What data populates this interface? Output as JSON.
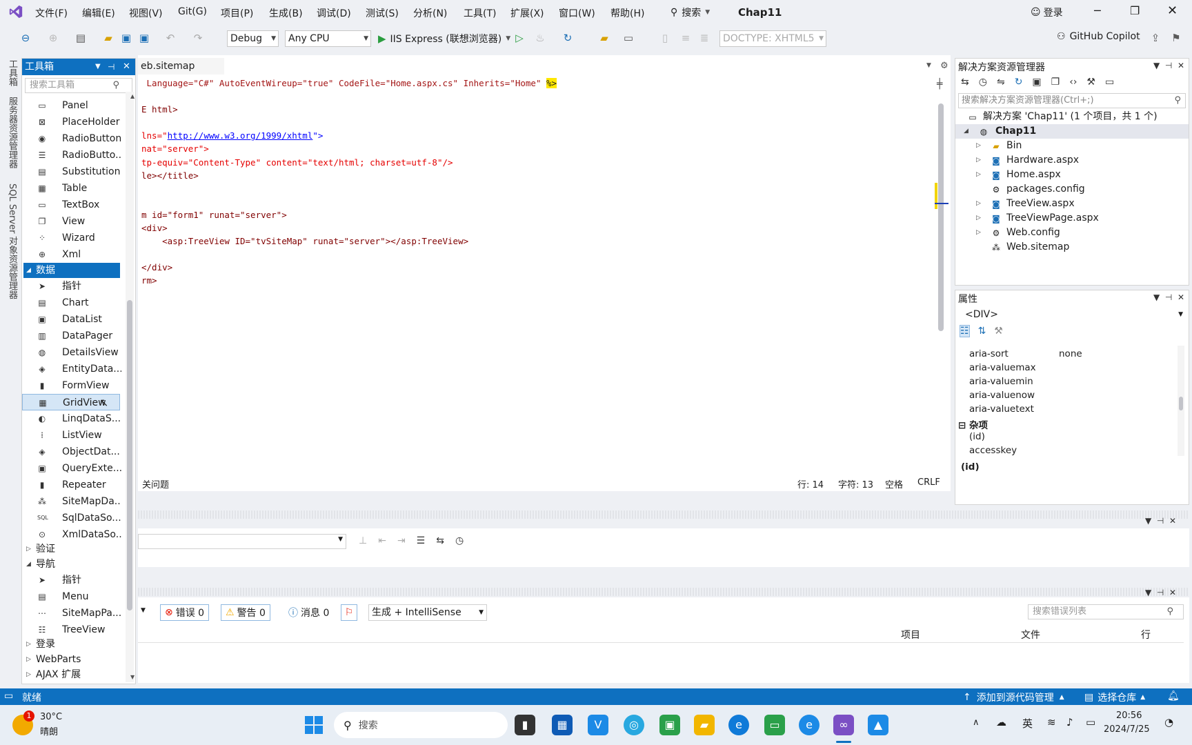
{
  "menu": {
    "items": [
      "文件(F)",
      "编辑(E)",
      "视图(V)",
      "Git(G)",
      "项目(P)",
      "生成(B)",
      "调试(D)",
      "测试(S)",
      "分析(N)",
      "工具(T)",
      "扩展(X)",
      "窗口(W)",
      "帮助(H)"
    ],
    "search": "搜索",
    "project_title": "Chap11",
    "login": "登录"
  },
  "toolbar": {
    "config": "Debug",
    "platform": "Any CPU",
    "run_target": "IIS Express (联想浏览器)",
    "doctype": "DOCTYPE: XHTML5",
    "copilot": "GitHub Copilot"
  },
  "vstrip": {
    "items": [
      "工具箱",
      "服务器资源管理器",
      "SQL Server 对象资源管理器"
    ]
  },
  "toolbox": {
    "title": "工具箱",
    "search_placeholder": "搜索工具箱",
    "items_top": [
      "Panel",
      "PlaceHolder",
      "RadioButton",
      "RadioButto...",
      "Substitution",
      "Table",
      "TextBox",
      "View",
      "Wizard",
      "Xml"
    ],
    "category_data": "数据",
    "items_data": [
      "指针",
      "Chart",
      "DataList",
      "DataPager",
      "DetailsView",
      "EntityData...",
      "FormView",
      "GridView",
      "LinqDataS...",
      "ListView",
      "ObjectDat...",
      "QueryExte...",
      "Repeater",
      "SiteMapDa...",
      "SqlDataSo...",
      "XmlDataSo..."
    ],
    "category_validate": "验证",
    "category_nav": "导航",
    "items_nav": [
      "指针",
      "Menu",
      "SiteMapPa...",
      "TreeView"
    ],
    "category_login": "登录",
    "category_webparts": "WebParts",
    "category_ajax": "AJAX 扩展"
  },
  "editor": {
    "tab": "eb.sitemap",
    "lines": {
      "l1a": " Language=\"C#\" AutoEventWireup=\"true\" CodeFile=\"Home.aspx.cs\" Inherits=\"Home\" ",
      "l1b": "%>",
      "l2": "E html>",
      "l3a": "lns=\"",
      "l3b": "http://www.w3.org/1999/xhtml",
      "l3c": "\">",
      "l4": "nat=\"server\">",
      "l5": "tp-equiv=\"Content-Type\" content=\"text/html; charset=utf-8\"/>",
      "l6": "le></title>",
      "l7": "m id=\"form1\" runat=\"server\">",
      "l8": "<div>",
      "l9": "    <asp:TreeView ID=\"tvSiteMap\" runat=\"server\"></asp:TreeView>",
      "l10": "</div>",
      "l11": "rm>"
    },
    "status": {
      "issues": "关问题",
      "line": "行: 14",
      "col": "字符: 13",
      "space": "空格",
      "eol": "CRLF"
    }
  },
  "solution": {
    "title": "解决方案资源管理器",
    "search_placeholder": "搜索解决方案资源管理器(Ctrl+;)",
    "solution_label": "解决方案 'Chap11' (1 个项目，共 1 个)",
    "project": "Chap11",
    "items": [
      "Bin",
      "Hardware.aspx",
      "Home.aspx",
      "packages.config",
      "TreeView.aspx",
      "TreeViewPage.aspx",
      "Web.config",
      "Web.sitemap"
    ]
  },
  "properties": {
    "title": "属性",
    "object": "<DIV>",
    "rows": [
      {
        "name": "aria-sort",
        "value": "none"
      },
      {
        "name": "aria-valuemax",
        "value": ""
      },
      {
        "name": "aria-valuemin",
        "value": ""
      },
      {
        "name": "aria-valuenow",
        "value": ""
      },
      {
        "name": "aria-valuetext",
        "value": ""
      }
    ],
    "category": "杂项",
    "misc_rows": [
      "(id)",
      "accesskey"
    ],
    "desc": "(id)"
  },
  "errorlist": {
    "errors": "错误 0",
    "warnings": "警告 0",
    "messages": "消息 0",
    "source": "生成 + IntelliSense",
    "search_placeholder": "搜索错误列表",
    "col_project": "项目",
    "col_file": "文件",
    "col_line": "行"
  },
  "statusbar": {
    "ready": "就绪",
    "source_control": "添加到源代码管理",
    "repo": "选择仓库"
  },
  "taskbar": {
    "weather_temp": "30°C",
    "weather_desc": "晴朗",
    "weather_badge": "1",
    "search": "搜索",
    "ime": "英",
    "time": "20:56",
    "date": "2024/7/25"
  },
  "colors": {
    "accent": "#0e70c0",
    "selection": "#0e70c0",
    "error": "#e51400",
    "warning": "#f2a900"
  }
}
